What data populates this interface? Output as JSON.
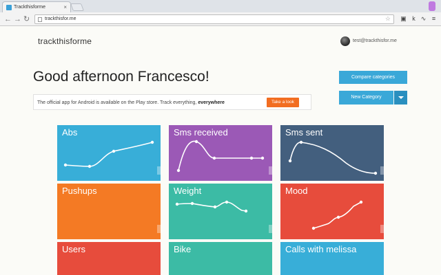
{
  "browser": {
    "tab_title": "Trackthisforme",
    "url": "trackthisfor.me"
  },
  "header": {
    "brand": "trackthisforme",
    "user_email": "test@trackthisfor.me"
  },
  "greeting": "Good afternoon Francesco!",
  "notice": {
    "text_before": "The official app for Android is available on the Play store. Track everything, ",
    "emphasis": "everywhere",
    "cta_label": "Take a look"
  },
  "actions": {
    "compare_label": "Compare categories",
    "new_category_label": "New Category"
  },
  "tiles": [
    {
      "label": "Abs",
      "color": "#38aed8"
    },
    {
      "label": "Sms received",
      "color": "#9b59b6"
    },
    {
      "label": "Sms sent",
      "color": "#435f7e"
    },
    {
      "label": "Pushups",
      "color": "#f47a24"
    },
    {
      "label": "Weight",
      "color": "#3cbba5"
    },
    {
      "label": "Mood",
      "color": "#e74c3c"
    },
    {
      "label": "Users",
      "color": "#e74c3c"
    },
    {
      "label": "Bike",
      "color": "#3cbba5"
    },
    {
      "label": "Calls with melissa",
      "color": "#38aed8"
    }
  ]
}
